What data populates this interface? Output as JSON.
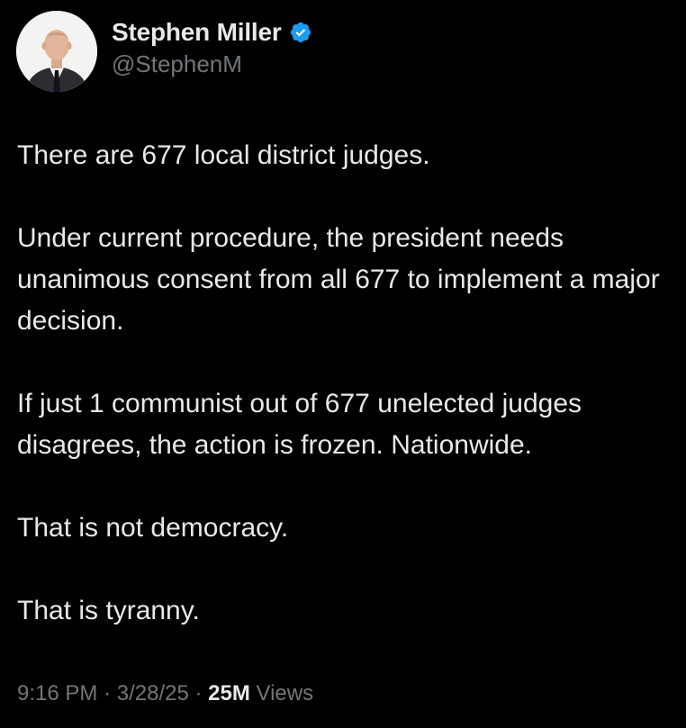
{
  "author": {
    "display_name": "Stephen Miller",
    "handle": "@StephenM",
    "verified_icon": "verified-badge-icon",
    "verified_color": "#1d9bf0"
  },
  "tweet": {
    "paragraphs": [
      "There are 677 local district judges.",
      "Under current procedure, the president needs unanimous consent from all 677 to implement a major decision.",
      "If just 1 communist out of 677 unelected judges disagrees, the action is frozen. Nationwide.",
      "That is not democracy.",
      "That is tyranny."
    ]
  },
  "meta": {
    "time": "9:16 PM",
    "separator": "·",
    "date": "3/28/25",
    "views_count": "25M",
    "views_label": "Views"
  },
  "colors": {
    "background": "#000000",
    "primary_text": "#e7e9ea",
    "secondary_text": "#71767b"
  }
}
